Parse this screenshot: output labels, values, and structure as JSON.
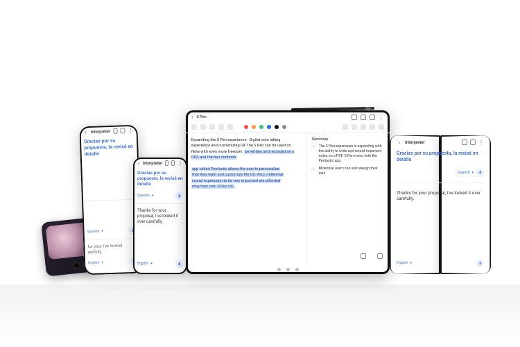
{
  "interpreter": {
    "app_title": "Interpreter",
    "translated_text": "Gracias por su propuesta, la revisé en detalle",
    "original_text": "Thanks for your proposal, I've looked it over carefully.",
    "target_lang": "Spanish",
    "source_lang": "English",
    "mic_icon": "mic-icon",
    "back_icon": "chevron-left-icon",
    "settings_icon": "settings-icon",
    "expand_icon": "expand-icon"
  },
  "flip_cover": {
    "original_short": "for your I've looked arefully."
  },
  "tablet": {
    "doc_title": "S Pen",
    "back_icon": "chevron-left-icon",
    "toolbar_colors": [
      "#ff4d4d",
      "#ff9a3c",
      "#3cc26b",
      "#2f6fe0",
      "#111111",
      "#8a8a8a"
    ],
    "note_text_plain_1": "Expanding the S Pen experience : Digital note taking experience and customizing UX The S Pen can be used on Note with even more freedom.",
    "note_text_hl_1": "be written and recorded on a PDF, and the two contents",
    "note_text_hl_2": "app called Pentastic allows the user to personalize",
    "note_text_hl_3": "that they want and customize the UX. Also, millennial",
    "note_text_hl_4": "rsonal expression to be very important are afforded",
    "note_text_hl_5": "ning their own S Pen UX.",
    "summary_heading": "Summary",
    "summary_items": [
      "The S Pen experience is expanding with the ability to write and record important notes on a PDF. S Pen menu with the Pentastic app.",
      "Millennial users can also design their own"
    ],
    "page_controls": {
      "left_icon": "copy-icon",
      "right_icon": "share-icon"
    }
  }
}
